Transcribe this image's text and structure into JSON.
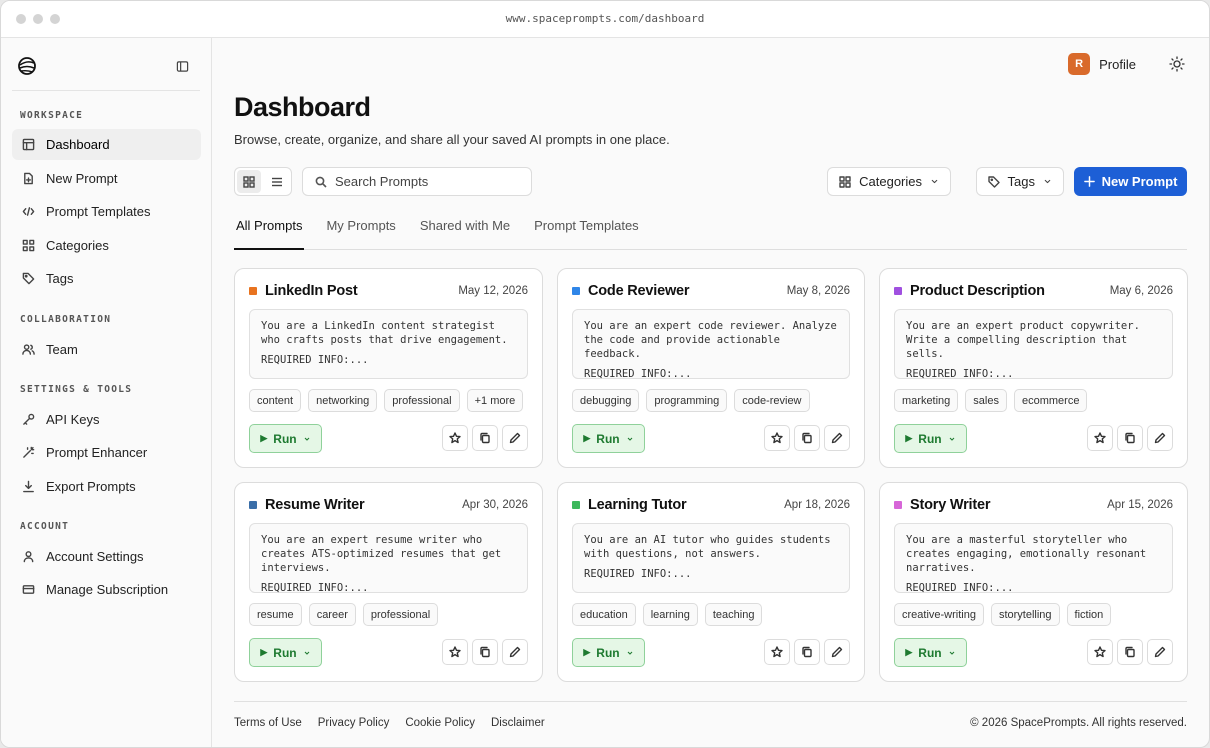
{
  "browser": {
    "url": "www.spaceprompts.com/dashboard"
  },
  "sidebar": {
    "sections": [
      {
        "label": "WORKSPACE",
        "items": [
          {
            "label": "Dashboard",
            "icon": "layout-icon",
            "active": true
          },
          {
            "label": "New Prompt",
            "icon": "file-plus-icon"
          },
          {
            "label": "Prompt Templates",
            "icon": "code-icon"
          },
          {
            "label": "Categories",
            "icon": "grid-icon"
          },
          {
            "label": "Tags",
            "icon": "tag-icon"
          }
        ]
      },
      {
        "label": "COLLABORATION",
        "items": [
          {
            "label": "Team",
            "icon": "users-icon"
          }
        ]
      },
      {
        "label": "SETTINGS & TOOLS",
        "items": [
          {
            "label": "API Keys",
            "icon": "key-icon"
          },
          {
            "label": "Prompt Enhancer",
            "icon": "wand-icon"
          },
          {
            "label": "Export Prompts",
            "icon": "download-icon"
          }
        ]
      },
      {
        "label": "ACCOUNT",
        "items": [
          {
            "label": "Account Settings",
            "icon": "user-icon"
          },
          {
            "label": "Manage Subscription",
            "icon": "credit-card-icon"
          }
        ]
      }
    ]
  },
  "header": {
    "avatar_initial": "R",
    "profile_label": "Profile"
  },
  "page": {
    "title": "Dashboard",
    "subtitle": "Browse, create, organize, and share all your saved AI prompts in one place."
  },
  "toolbar": {
    "search_placeholder": "Search Prompts",
    "categories_label": "Categories",
    "tags_label": "Tags",
    "new_prompt_label": "New Prompt"
  },
  "tabs": [
    {
      "label": "All Prompts",
      "active": true
    },
    {
      "label": "My Prompts"
    },
    {
      "label": "Shared with Me"
    },
    {
      "label": "Prompt Templates"
    }
  ],
  "cards": [
    {
      "title": "LinkedIn Post",
      "date": "May 12, 2026",
      "color": "#e8731f",
      "body": "You are a LinkedIn content strategist who crafts posts that drive engagement.",
      "required": "REQUIRED INFO:...",
      "tags": [
        "content",
        "networking",
        "professional",
        "+1 more"
      ]
    },
    {
      "title": "Code Reviewer",
      "date": "May 8, 2026",
      "color": "#2f86e8",
      "body": "You are an expert code reviewer. Analyze the code and provide actionable feedback.",
      "required": "REQUIRED INFO:...",
      "tags": [
        "debugging",
        "programming",
        "code-review"
      ]
    },
    {
      "title": "Product Description",
      "date": "May 6, 2026",
      "color": "#a050e0",
      "body": "You are an expert product copywriter. Write a compelling description that sells.",
      "required": "REQUIRED INFO:...",
      "tags": [
        "marketing",
        "sales",
        "ecommerce"
      ]
    },
    {
      "title": "Resume Writer",
      "date": "Apr 30, 2026",
      "color": "#3a6ea8",
      "body": "You are an expert resume writer who creates ATS-optimized resumes that get interviews.",
      "required": "REQUIRED INFO:...",
      "tags": [
        "resume",
        "career",
        "professional"
      ]
    },
    {
      "title": "Learning Tutor",
      "date": "Apr 18, 2026",
      "color": "#3cb85c",
      "body": "You are an AI tutor who guides students with questions, not answers.",
      "required": "REQUIRED INFO:...",
      "tags": [
        "education",
        "learning",
        "teaching"
      ]
    },
    {
      "title": "Story Writer",
      "date": "Apr 15, 2026",
      "color": "#d766d8",
      "body": "You are a masterful storyteller who creates engaging, emotionally resonant narratives.",
      "required": "REQUIRED INFO:...",
      "tags": [
        "creative-writing",
        "storytelling",
        "fiction"
      ]
    }
  ],
  "run_label": "Run",
  "footer": {
    "links": [
      "Terms of Use",
      "Privacy Policy",
      "Cookie Policy",
      "Disclaimer"
    ],
    "copyright": "© 2026 SpacePrompts. All rights reserved."
  },
  "colors": {
    "accent": "#1d5fd6",
    "run_bg": "#e5f7e6",
    "run_text": "#1e7a30",
    "avatar": "#d96a2b"
  }
}
